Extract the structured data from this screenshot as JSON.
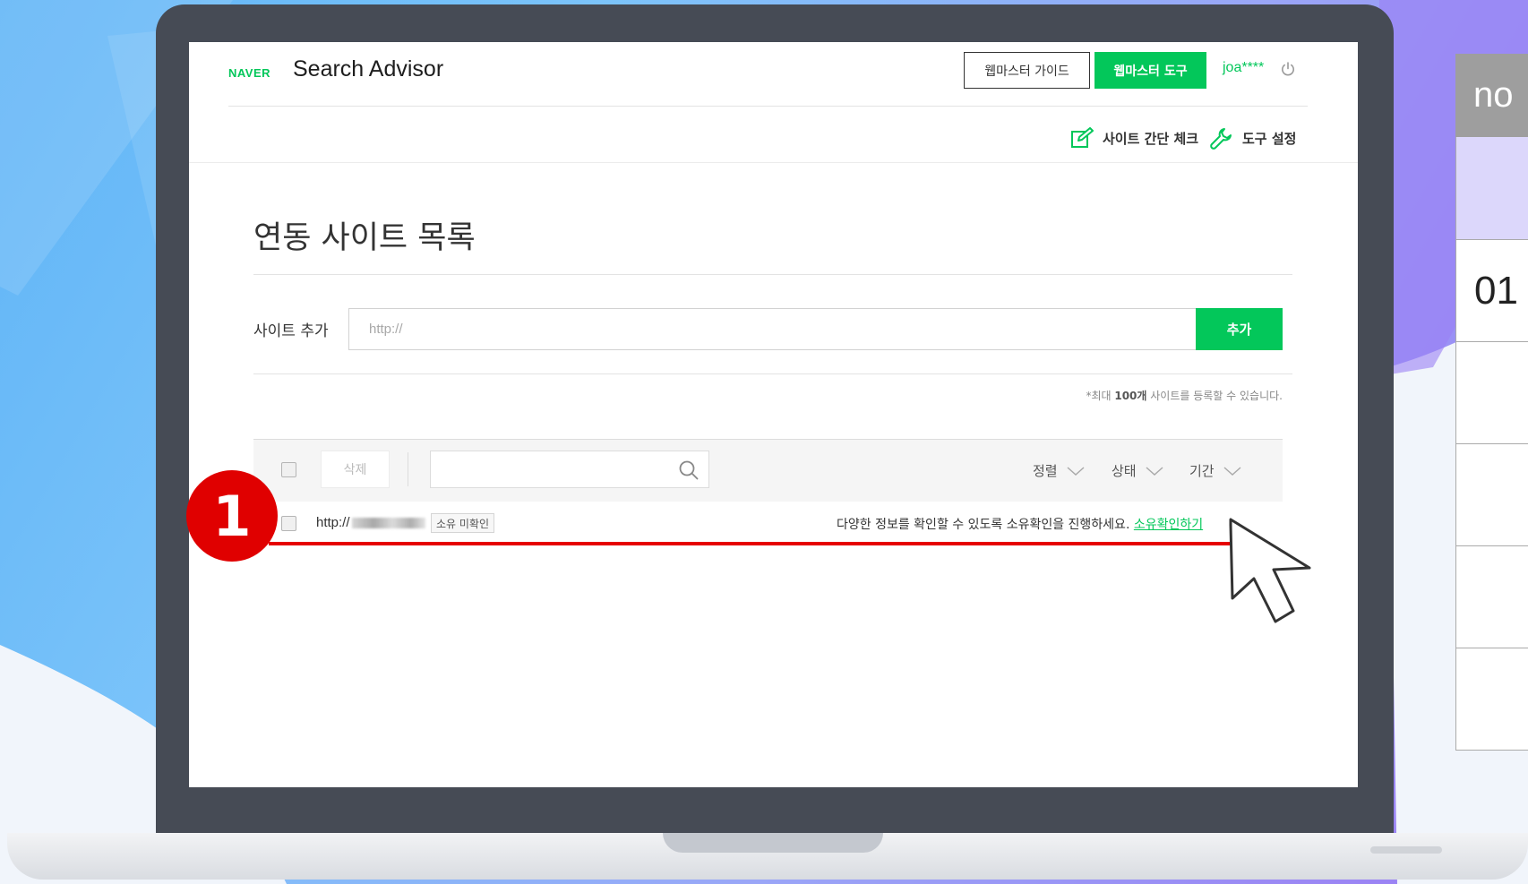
{
  "app": {
    "logo": "NAVER",
    "title": "Search Advisor",
    "guide_button": "웹마스터 가이드",
    "tools_button": "웹마스터 도구",
    "user_id": "joa****"
  },
  "sub_nav": {
    "site_check": "사이트 간단 체크",
    "tool_settings": "도구 설정"
  },
  "page": {
    "title": "연동 사이트 목록",
    "add_label": "사이트 추가",
    "url_placeholder": "http://",
    "add_button": "추가",
    "note_prefix": "*최대 ",
    "note_bold": "100개",
    "note_suffix": " 사이트를 등록할 수 있습니다."
  },
  "toolbar": {
    "delete_button": "삭제",
    "filters": [
      "정렬",
      "상태",
      "기간"
    ]
  },
  "sites": [
    {
      "url_prefix": "http://",
      "status": "소유 미확인",
      "message": "다양한 정보를 확인할 수 있도록 소유확인을 진행하세요.",
      "link": "소유확인하기"
    }
  ],
  "annotation": {
    "step_number": "1"
  },
  "side_table": {
    "header": "no",
    "rows": [
      "01",
      "",
      "",
      "",
      ""
    ]
  },
  "colors": {
    "naver_green": "#03c75a",
    "annotation_red": "#e60000"
  }
}
